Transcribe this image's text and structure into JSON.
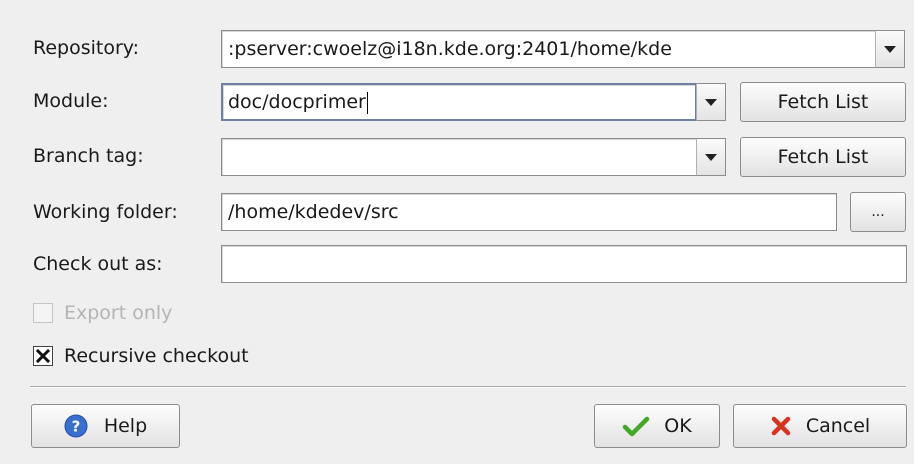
{
  "form": {
    "repository": {
      "label": "Repository:",
      "value": ":pserver:cwoelz@i18n.kde.org:2401/home/kde"
    },
    "module": {
      "label": "Module:",
      "value": "doc/docprimer",
      "fetch_label": "Fetch List"
    },
    "branch_tag": {
      "label": "Branch tag:",
      "value": "",
      "fetch_label": "Fetch List"
    },
    "working_folder": {
      "label": "Working folder:",
      "value": "/home/kdedev/src",
      "browse_label": "..."
    },
    "check_out_as": {
      "label": "Check out as:",
      "value": ""
    },
    "export_only": {
      "label": "Export only",
      "checked": false,
      "disabled": true
    },
    "recursive_checkout": {
      "label": "Recursive checkout",
      "checked": true
    }
  },
  "buttons": {
    "help": "Help",
    "ok": "OK",
    "cancel": "Cancel"
  },
  "colors": {
    "background": "#efefef",
    "help_icon": "#3a6fd0",
    "ok_icon": "#44a827",
    "cancel_icon": "#d8331e"
  },
  "icons": {
    "help": "help-icon",
    "ok": "checkmark-icon",
    "cancel": "cancel-x-icon",
    "dropdown": "chevron-down-icon"
  }
}
